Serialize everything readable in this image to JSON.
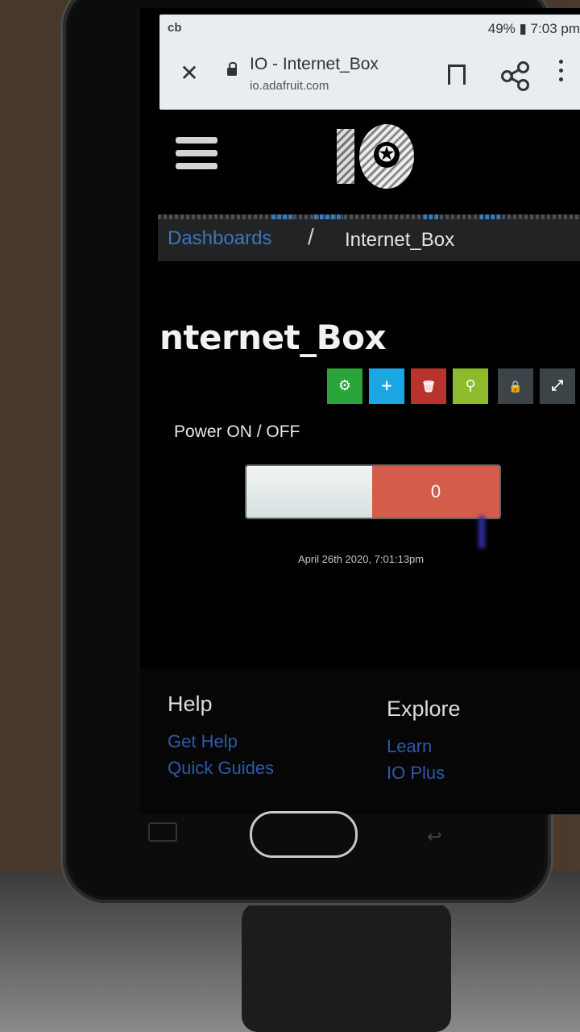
{
  "status_bar": {
    "carrier": "cb",
    "right": "49% ▮ 7:03 pm"
  },
  "browser": {
    "tab_title": "IO - Internet_Box",
    "url": "io.adafruit.com"
  },
  "breadcrumb": {
    "link": "Dashboards",
    "separator": "/",
    "current": "Internet_Box"
  },
  "page_title": "nternet_Box",
  "toolbar": [
    {
      "name": "settings",
      "icon": "gear-icon",
      "glyph": "⚙",
      "color": "#2aa53a"
    },
    {
      "name": "add-block",
      "icon": "plus-icon",
      "glyph": "+",
      "color": "#1ba6e4"
    },
    {
      "name": "delete",
      "icon": "trash-icon",
      "glyph": "🗑",
      "color": "#b8322e"
    },
    {
      "name": "keys",
      "icon": "key-icon",
      "glyph": "⚲",
      "color": "#8dbb2c"
    },
    {
      "name": "lock",
      "icon": "lock-icon",
      "glyph": "🔒",
      "color": "#3d4448"
    },
    {
      "name": "fullscreen",
      "icon": "expand-icon",
      "glyph": "⤢",
      "color": "#3d4448"
    }
  ],
  "block": {
    "title": "Power ON / OFF",
    "value": "0",
    "value_color": "#d45d4a",
    "timestamp": "April 26th 2020, 7:01:13pm"
  },
  "footer": {
    "help": {
      "heading": "Help",
      "links": [
        "Get Help",
        "Quick Guides"
      ]
    },
    "explore": {
      "heading": "Explore",
      "links": [
        "Learn",
        "IO Plus"
      ]
    }
  }
}
